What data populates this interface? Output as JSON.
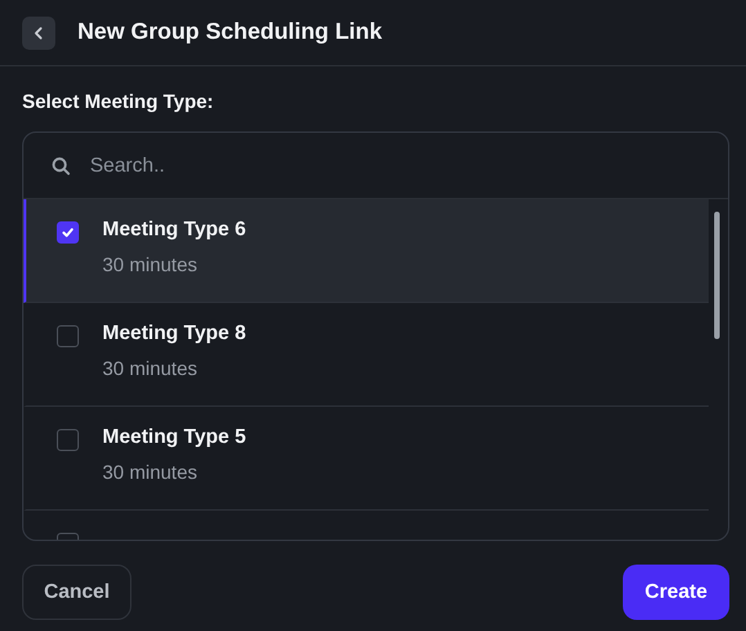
{
  "header": {
    "title": "New Group Scheduling Link"
  },
  "section_label": "Select Meeting Type:",
  "search": {
    "placeholder": "Search.."
  },
  "meeting_types": [
    {
      "name": "Meeting Type 6",
      "duration": "30 minutes",
      "checked": true,
      "selected": true
    },
    {
      "name": "Meeting Type 8",
      "duration": "30 minutes",
      "checked": false,
      "selected": false
    },
    {
      "name": "Meeting Type 5",
      "duration": "30 minutes",
      "checked": false,
      "selected": false
    },
    {
      "checked": false,
      "selected": false
    }
  ],
  "buttons": {
    "cancel": "Cancel",
    "create": "Create"
  }
}
